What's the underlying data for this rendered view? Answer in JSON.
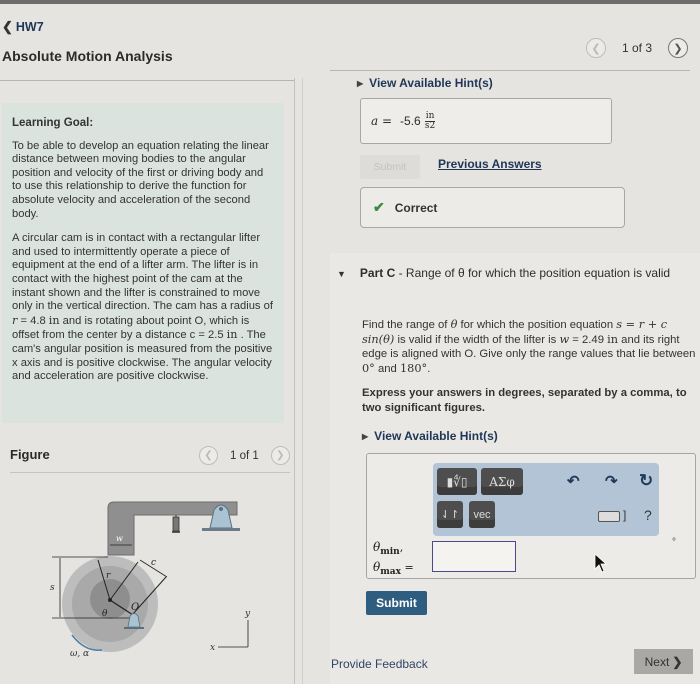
{
  "header": {
    "back_label": "HW7",
    "back_icon": "chevron-left-icon",
    "title": "Absolute Motion Analysis"
  },
  "pager": {
    "prev_icon": "chevron-left-icon",
    "text": "1 of 3",
    "next_icon": "chevron-right-icon"
  },
  "learning_goal": {
    "heading": "Learning Goal:",
    "goal_text": "To be able to develop an equation relating the linear distance between moving bodies to the angular position and velocity of the first or driving body and to use this relationship to derive the function for absolute velocity and acceleration of the second body.",
    "problem_part1": "A circular cam is in contact with a rectangular lifter and used to intermittently operate a piece of equipment at the end of a lifter arm. The lifter is in contact with the highest point of the cam at the instant shown and the lifter is constrained to move only in the vertical direction. The cam has a radius of ",
    "r_var": "r",
    "r_eq": " = 4.8 ",
    "r_unit": "in",
    "problem_part2": " and is rotating about point O, which is offset from the center by a distance ",
    "c_eq": "c = 2.5 ",
    "c_unit": "in",
    "problem_part3": " . The cam's angular position is measured from the positive x axis and is positive clockwise. The angular velocity and acceleration are positive clockwise."
  },
  "figure": {
    "label": "Figure",
    "pager_text": "1 of 1",
    "labels": {
      "w": "w",
      "r": "r",
      "c": "c",
      "s": "s",
      "theta": "θ",
      "O": "O",
      "omega_alpha": "ω, α",
      "x": "x",
      "y": "y"
    }
  },
  "part_b": {
    "hint_label": "View Available Hint(s)",
    "answer_var": "a =",
    "answer_value": "-5.6",
    "answer_unit_num": "in",
    "answer_unit_den": "s2",
    "submit_label": "Submit",
    "previous_answers_label": "Previous Answers",
    "result_label": "Correct"
  },
  "part_c": {
    "title_bold": "Part C",
    "title_rest": " - Range of θ for which the position equation is valid",
    "question_1": "Find the range of ",
    "question_theta": "θ",
    "question_2": " for which the position equation ",
    "question_eq": "s = r + c sin(θ)",
    "question_3": " is valid if the width of the lifter is ",
    "question_w": "w",
    "question_w_val": " = 2.49 ",
    "question_w_unit": "in",
    "question_4": " and its right edge is aligned with O. Give only the range values that lie between ",
    "question_deg0": "0°",
    "question_and": " and ",
    "question_deg180": "180°",
    "question_end": ".",
    "instructions": "Express your answers in degrees, separated by a comma, to two significant figures.",
    "hint_label": "View Available Hint(s)",
    "toolbar": {
      "templates_label": "▮∜▯",
      "greek_label": "ΑΣφ",
      "updown_label": "⇃↾",
      "vec_label": "vec",
      "undo_icon": "undo-icon",
      "redo_icon": "redo-icon",
      "reset_icon": "reset-icon",
      "keyboard_icon": "keyboard-icon",
      "help_label": "?"
    },
    "input_label_theta": "θ",
    "input_label_min": "min",
    "input_label_max": "max",
    "input_value": "",
    "unit_symbol": "°",
    "submit_label": "Submit"
  },
  "footer": {
    "feedback_label": "Provide Feedback",
    "next_label": "Next"
  }
}
